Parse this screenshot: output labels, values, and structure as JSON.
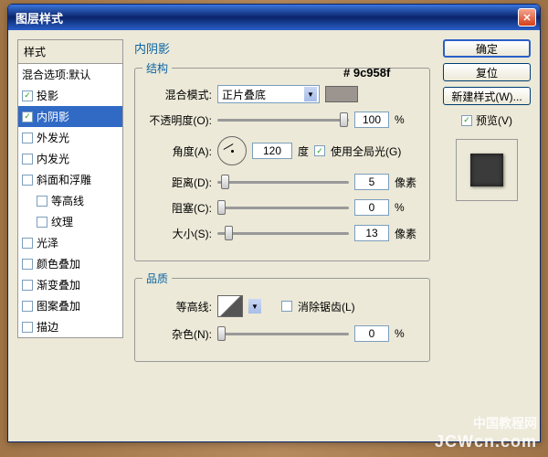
{
  "window": {
    "title": "图层样式"
  },
  "left": {
    "header": "样式",
    "items": [
      {
        "label": "混合选项:默认",
        "checked": null
      },
      {
        "label": "投影",
        "checked": true
      },
      {
        "label": "内阴影",
        "checked": true,
        "selected": true
      },
      {
        "label": "外发光",
        "checked": false
      },
      {
        "label": "内发光",
        "checked": false
      },
      {
        "label": "斜面和浮雕",
        "checked": false
      },
      {
        "label": "等高线",
        "checked": false,
        "indent": true
      },
      {
        "label": "纹理",
        "checked": false,
        "indent": true
      },
      {
        "label": "光泽",
        "checked": false
      },
      {
        "label": "颜色叠加",
        "checked": false
      },
      {
        "label": "渐变叠加",
        "checked": false
      },
      {
        "label": "图案叠加",
        "checked": false
      },
      {
        "label": "描边",
        "checked": false
      }
    ]
  },
  "center": {
    "heading": "内阴影",
    "structure_legend": "结构",
    "quality_legend": "品质",
    "blend_label": "混合模式:",
    "blend_value": "正片叠底",
    "color_hex": "# 9c958f",
    "opacity_label": "不透明度(O):",
    "opacity_value": "100",
    "opacity_unit": "%",
    "angle_label": "角度(A):",
    "angle_value": "120",
    "angle_unit": "度",
    "global_light": "使用全局光(G)",
    "distance_label": "距离(D):",
    "distance_value": "5",
    "distance_unit": "像素",
    "choke_label": "阻塞(C):",
    "choke_value": "0",
    "choke_unit": "%",
    "size_label": "大小(S):",
    "size_value": "13",
    "size_unit": "像素",
    "contour_label": "等高线:",
    "antialias": "消除锯齿(L)",
    "noise_label": "杂色(N):",
    "noise_value": "0",
    "noise_unit": "%"
  },
  "right": {
    "ok": "确定",
    "cancel": "复位",
    "new_style": "新建样式(W)...",
    "preview": "预览(V)"
  },
  "watermark": {
    "line1": "中国教程网",
    "line2": "JCWcn.com"
  }
}
